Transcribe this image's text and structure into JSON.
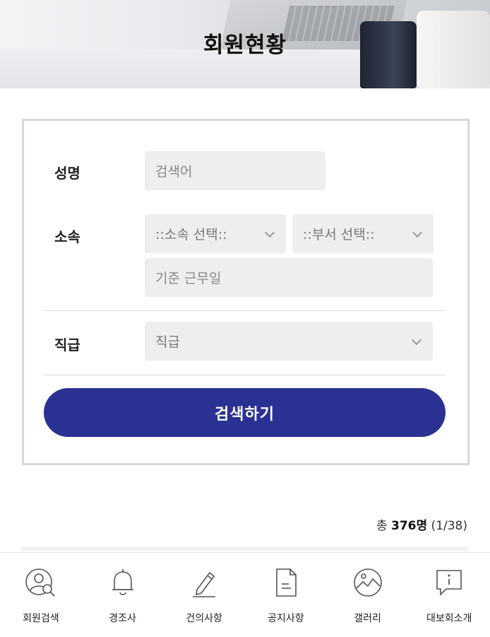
{
  "header": {
    "title": "회원현황"
  },
  "form": {
    "name_label": "성명",
    "name_placeholder": "검색어",
    "affiliation_label": "소속",
    "affiliation_select": "::소속 선택::",
    "department_select": "::부서 선택::",
    "work_date_placeholder": "기준 근무일",
    "rank_label": "직급",
    "rank_select": "직급",
    "search_button": "검색하기"
  },
  "results": {
    "total_prefix": "총 ",
    "count": "376명",
    "pages": " (1/38)"
  },
  "bottom_nav": {
    "items": [
      {
        "label": "회원검색",
        "icon": "user-search-icon"
      },
      {
        "label": "경조사",
        "icon": "bell-icon"
      },
      {
        "label": "건의사항",
        "icon": "pencil-icon"
      },
      {
        "label": "공지사항",
        "icon": "document-icon"
      },
      {
        "label": "갤러리",
        "icon": "gallery-icon"
      },
      {
        "label": "대보회소개",
        "icon": "info-icon"
      }
    ]
  },
  "colors": {
    "accent": "#2a3192",
    "field_bg": "#eeeeee",
    "border": "#d8d8d8"
  }
}
